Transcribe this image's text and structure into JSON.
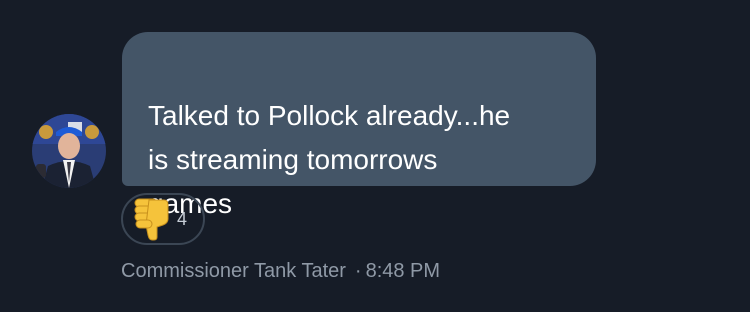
{
  "message": {
    "text": "Talked to Pollock already...he\nis streaming tomorrows\ngames",
    "sender": "Commissioner Tank Tater",
    "separator": "·",
    "time": "8:48 PM"
  },
  "reaction": {
    "emoji_icon": "thumbs-down-icon",
    "count": "4"
  },
  "colors": {
    "background": "#161c27",
    "bubble": "#445567",
    "reaction_border": "#3b4654",
    "meta_text": "#8f99a6"
  }
}
